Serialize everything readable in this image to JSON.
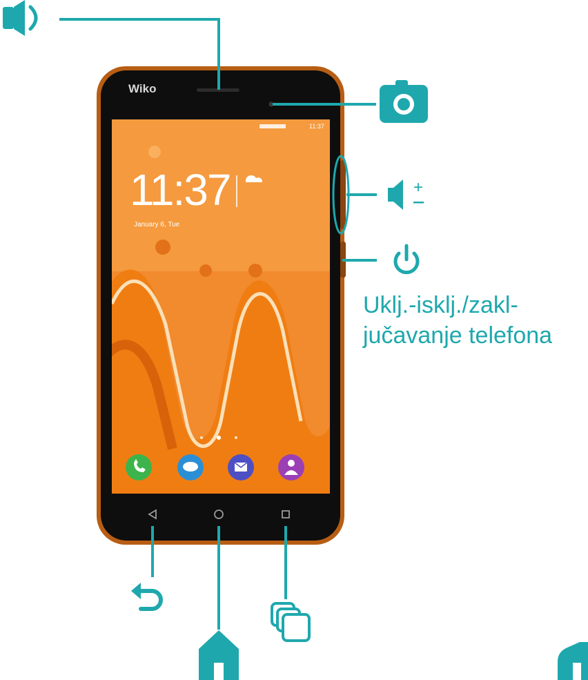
{
  "colors": {
    "accent": "#1ea8ad",
    "phone_body": "#b75e14",
    "screen_bg": "#f28a2e",
    "bezel": "#0e0e0e"
  },
  "phone": {
    "brand": "Wiko",
    "clock_time": "11:37",
    "clock_date": "January 6, Tue",
    "status_time": "11:37"
  },
  "callouts": {
    "power_label_line1": "Uklj.-isklj./zakl-",
    "power_label_line2": "jučavanje telefona"
  },
  "icons": [
    "speaker-icon",
    "camera-icon",
    "volume-icon",
    "power-icon",
    "back-arrow-icon",
    "home-icon",
    "recent-apps-icon"
  ]
}
